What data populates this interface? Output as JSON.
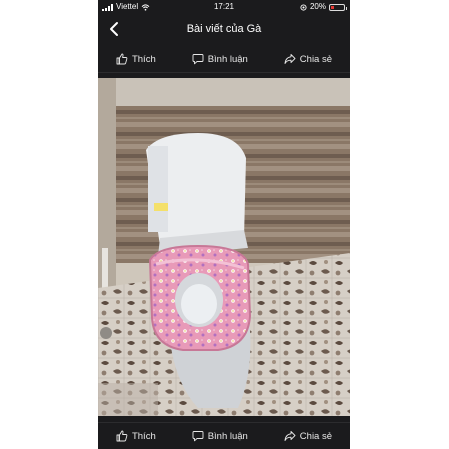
{
  "status": {
    "carrier": "Viettel",
    "time": "17:21",
    "battery": "20%"
  },
  "header": {
    "title": "Bài viết của Gà"
  },
  "actions": {
    "like": "Thích",
    "comment": "Bình luận",
    "share": "Chia sẻ"
  },
  "photo": {
    "subject": "toilet-with-pink-floral-seat-cover"
  },
  "colors": {
    "app_bg": "#1b1b1d",
    "seat_cover": "#e89ab8",
    "tile_dark": "#6b5a4e"
  }
}
